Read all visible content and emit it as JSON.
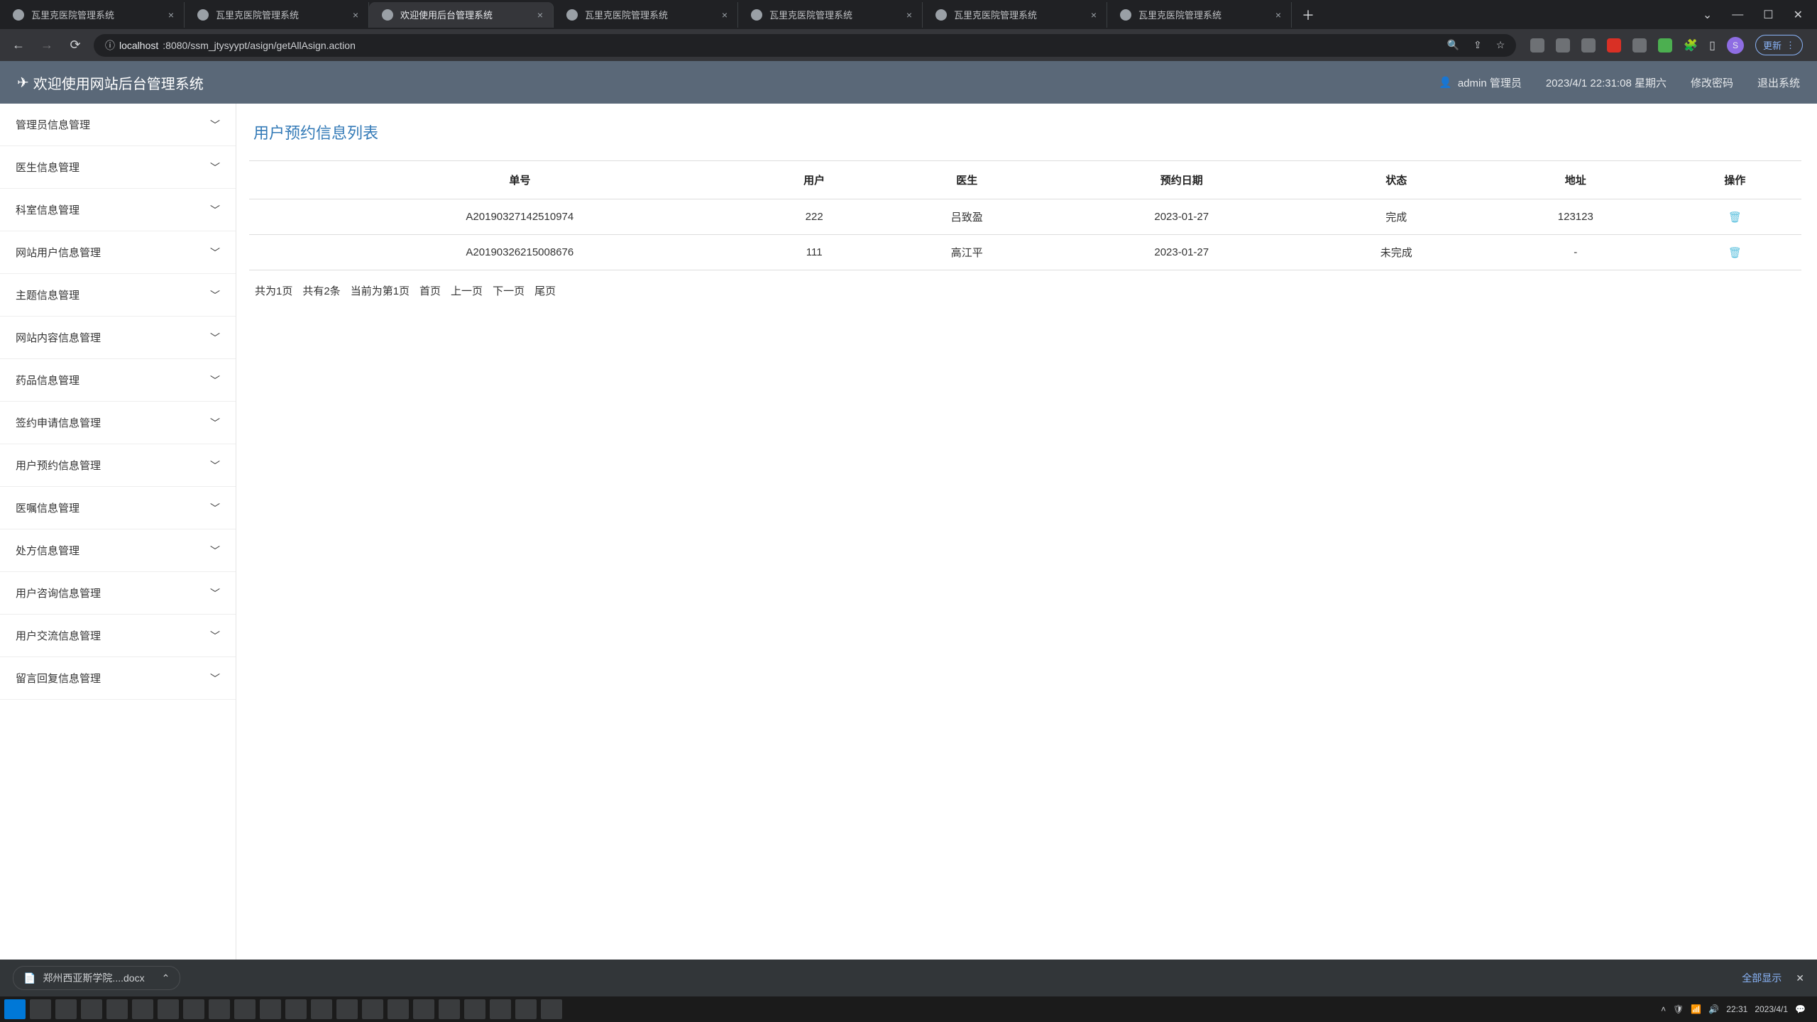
{
  "browser": {
    "tabs": [
      {
        "title": "瓦里克医院管理系统",
        "active": false
      },
      {
        "title": "瓦里克医院管理系统",
        "active": false
      },
      {
        "title": "欢迎使用后台管理系统",
        "active": true
      },
      {
        "title": "瓦里克医院管理系统",
        "active": false
      },
      {
        "title": "瓦里克医院管理系统",
        "active": false
      },
      {
        "title": "瓦里克医院管理系统",
        "active": false
      },
      {
        "title": "瓦里克医院管理系统",
        "active": false
      }
    ],
    "url_prefix": "localhost",
    "url_rest": ":8080/ssm_jtysyypt/asign/getAllAsign.action",
    "update_label": "更新",
    "avatar_letter": "S"
  },
  "header": {
    "title": "欢迎使用网站后台管理系统",
    "user": "admin 管理员",
    "datetime": "2023/4/1 22:31:08 星期六",
    "change_pwd": "修改密码",
    "logout": "退出系统"
  },
  "sidebar": {
    "items": [
      "管理员信息管理",
      "医生信息管理",
      "科室信息管理",
      "网站用户信息管理",
      "主题信息管理",
      "网站内容信息管理",
      "药品信息管理",
      "签约申请信息管理",
      "用户预约信息管理",
      "医嘱信息管理",
      "处方信息管理",
      "用户咨询信息管理",
      "用户交流信息管理",
      "留言回复信息管理"
    ]
  },
  "page": {
    "title": "用户预约信息列表",
    "columns": [
      "单号",
      "用户",
      "医生",
      "预约日期",
      "状态",
      "地址",
      "操作"
    ],
    "rows": [
      {
        "order": "A20190327142510974",
        "user": "222",
        "doctor": "吕致盈",
        "date": "2023-01-27",
        "status": "完成",
        "addr": "123123"
      },
      {
        "order": "A20190326215008676",
        "user": "111",
        "doctor": "高江平",
        "date": "2023-01-27",
        "status": "未完成",
        "addr": "-"
      }
    ],
    "pagination": {
      "total_pages": "共为1页",
      "total_rows": "共有2条",
      "current": "当前为第1页",
      "first": "首页",
      "prev": "上一页",
      "next": "下一页",
      "last": "尾页"
    }
  },
  "download": {
    "filename": "郑州西亚斯学院....docx",
    "showall": "全部显示"
  },
  "tray": {
    "clock": "22:31",
    "date": "2023/4/1"
  }
}
